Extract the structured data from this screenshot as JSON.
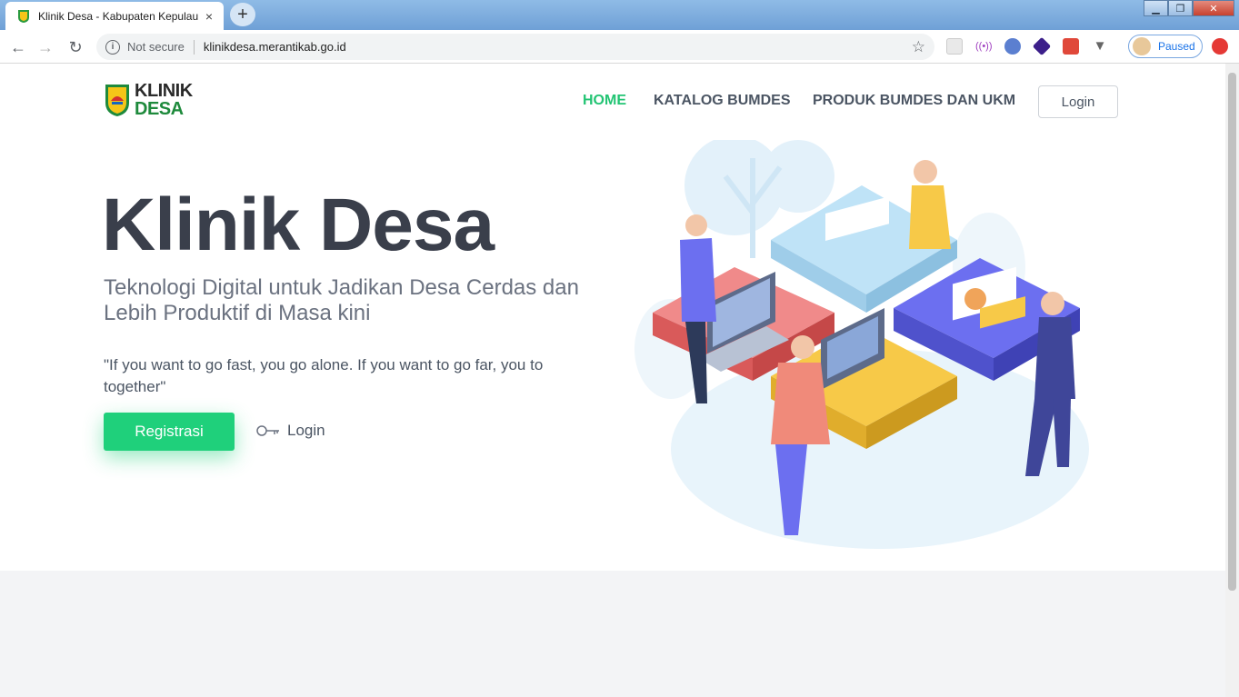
{
  "browser": {
    "tab_title": "Klinik Desa - Kabupaten Kepulau",
    "tab_close": "×",
    "new_tab": "+",
    "security_label": "Not secure",
    "url": "klinikdesa.merantikab.go.id",
    "profile_status": "Paused",
    "window_controls": {
      "minimize": "▁",
      "maximize": "❐",
      "close": "✕"
    }
  },
  "site": {
    "logo": {
      "line1": "KLINIK",
      "line2": "DESA"
    },
    "nav": [
      {
        "label": "HOME",
        "active": true
      },
      {
        "label": "KATALOG BUMDES",
        "active": false
      },
      {
        "label": "PRODUK BUMDES DAN UKM",
        "active": false
      }
    ],
    "login_button": "Login"
  },
  "hero": {
    "title": "Klinik Desa",
    "subtitle": "Teknologi Digital untuk Jadikan Desa Cerdas dan Lebih Produktif di Masa kini",
    "quote": "\"If you want to go fast, you go alone. If you want to go far, you to together\"",
    "register_button": "Registrasi",
    "login_link": "Login"
  },
  "colors": {
    "accent": "#1fd07b",
    "nav_active": "#22c473",
    "title": "#3a3f4b",
    "footer_band": "#f3f4f6"
  },
  "icons": [
    "info-icon",
    "star-icon",
    "back-arrow-icon",
    "forward-arrow-icon",
    "reload-icon",
    "key-icon",
    "shield-logo-icon"
  ]
}
